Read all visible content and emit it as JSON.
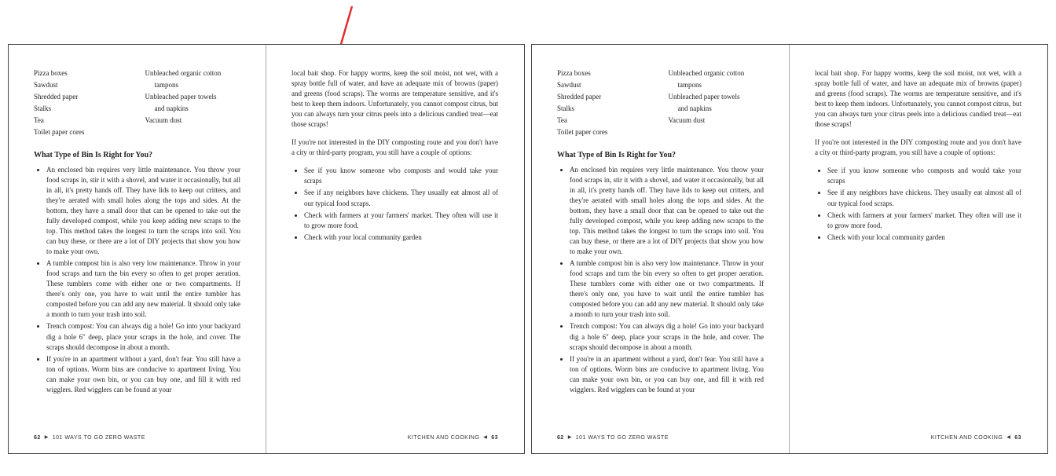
{
  "materials_col1": [
    "Pizza boxes",
    "Sawdust",
    "Shredded paper",
    "Stalks",
    "Tea",
    "Toilet paper cores"
  ],
  "materials_col2_lines": [
    "Unbleached organic cotton",
    "tampons",
    "Unbleached paper towels",
    "and napkins",
    "Vacuum dust"
  ],
  "indent_indices": [
    1,
    3
  ],
  "heading": "What Type of Bin Is Right for You?",
  "bin_bullets": [
    "An enclosed bin requires very little maintenance. You throw your food scraps in, stir it with a shovel, and water it occasionally, but all in all, it's pretty hands off. They have lids to keep out critters, and they're aerated with small holes along the tops and sides. At the bottom, they have a small door that can be opened to take out the fully developed compost, while you keep adding new scraps to the top. This method takes the longest to turn the scraps into soil. You can buy these, or there are a lot of DIY projects that show you how to make your own.",
    "A tumble compost bin is also very low maintenance. Throw in your food scraps and turn the bin every so often to get proper aeration. These tumblers come with either one or two compartments. If there's only one, you have to wait until the entire tumbler has composted before you can add any new material. It should only take a month to turn your trash into soil.",
    "Trench compost: You can always dig a hole! Go into your backyard dig a hole 6\" deep, place your scraps in the hole, and cover. The scraps should decompose in about a month.",
    "If you're in an apartment without a yard, don't fear. You still have a ton of options. Worm bins are conducive to apartment living. You can make your own bin, or you can buy one, and fill it with red wigglers. Red wigglers can be found at your"
  ],
  "right_para1": "local bait shop. For happy worms, keep the soil moist, not wet, with a spray bottle full of water, and have an adequate mix of browns (paper) and greens (food scraps). The worms are temperature sensitive, and it's best to keep them indoors. Unfortunately, you cannot compost citrus, but you can always turn your citrus peels into a delicious candied treat—eat those scraps!",
  "right_para2": "If you're not interested in the DIY composting route and you don't have a city or third-party program, you still have a couple of options:",
  "options_bullets": [
    "See if you know someone who composts and would take your scraps",
    "See if any neighbors have chickens. They usually eat almost all of our typical food scraps.",
    "Check with farmers at your farmers' market. They often will use it to grow more food.",
    "Check with your local community garden"
  ],
  "footer_left_page": "62",
  "footer_left_text": "101 WAYS TO GO ZERO WASTE",
  "footer_right_text": "KITCHEN AND COOKING",
  "footer_right_page": "63"
}
